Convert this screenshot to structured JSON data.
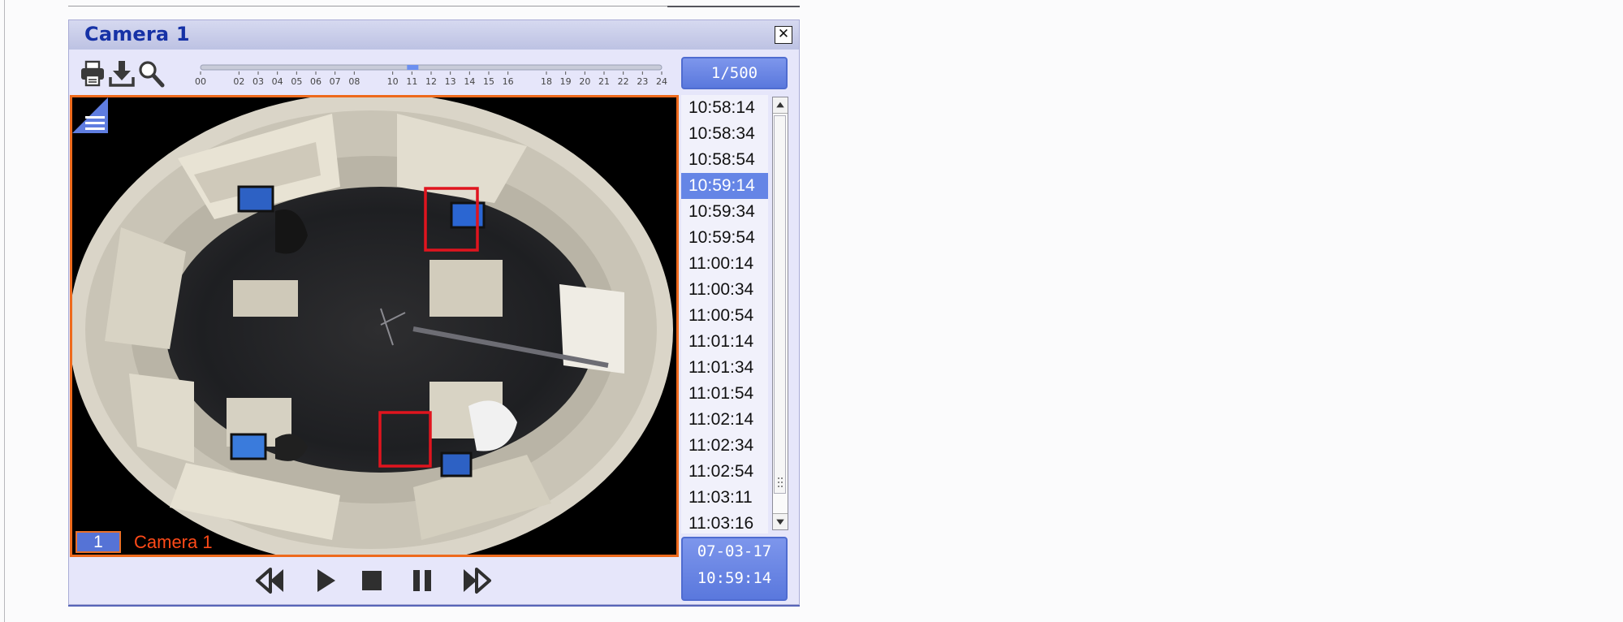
{
  "window": {
    "title": "Camera 1",
    "close_glyph": "✕"
  },
  "toolbar": {
    "icons": [
      "printer-icon",
      "download-icon",
      "magnifier-icon"
    ],
    "timeline_hours": [
      "00",
      "02",
      "03",
      "04",
      "05",
      "06",
      "07",
      "08",
      "10",
      "11",
      "12",
      "13",
      "14",
      "15",
      "16",
      "18",
      "19",
      "20",
      "21",
      "22",
      "23",
      "24"
    ],
    "frame_counter": "1/500"
  },
  "video": {
    "camera_number": "1",
    "camera_label": "Camera 1",
    "detection_boxes": 2
  },
  "timestamps": {
    "items": [
      "10:58:14",
      "10:58:34",
      "10:58:54",
      "10:59:14",
      "10:59:34",
      "10:59:54",
      "11:00:14",
      "11:00:34",
      "11:00:54",
      "11:01:14",
      "11:01:34",
      "11:01:54",
      "11:02:14",
      "11:02:34",
      "11:02:54",
      "11:03:11",
      "11:03:16"
    ],
    "selected_index": 3
  },
  "datetime": {
    "date": "07-03-17",
    "time": "10:59:14"
  },
  "playback": {
    "controls": [
      "rewind-icon",
      "play-icon",
      "stop-icon",
      "pause-icon",
      "fast-forward-icon"
    ]
  },
  "colors": {
    "accent": "#5a78dd",
    "title_text": "#1632a6",
    "video_border": "#ee6a1c",
    "camera_label": "#ff4a18",
    "detection_box": "#e0141e"
  }
}
